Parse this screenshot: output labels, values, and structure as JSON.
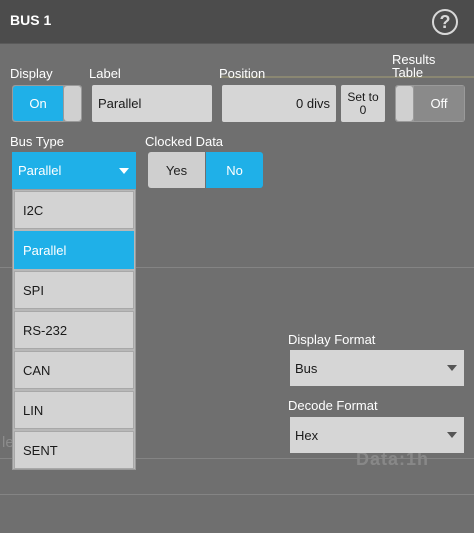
{
  "window": {
    "title": "BUS 1",
    "help_glyph": "?"
  },
  "display": {
    "label": "Display",
    "value": "On"
  },
  "label_field": {
    "label": "Label",
    "value": "Parallel"
  },
  "position": {
    "label": "Position",
    "value": "0 divs",
    "set_button": "Set to 0"
  },
  "results_table": {
    "label": "Results Table",
    "value": "Off"
  },
  "bus_type": {
    "label": "Bus Type",
    "selected": "Parallel",
    "options": [
      "I2C",
      "Parallel",
      "SPI",
      "RS-232",
      "CAN",
      "LIN",
      "SENT"
    ]
  },
  "clocked_data": {
    "label": "Clocked Data",
    "yes": "Yes",
    "no": "No",
    "selected": "No"
  },
  "display_format": {
    "label": "Display Format",
    "value": "Bus"
  },
  "decode_format": {
    "label": "Decode Format",
    "value": "Hex"
  },
  "background": {
    "watermark": "Data:1h",
    "edge_text": "le"
  },
  "colors": {
    "accent": "#1fb0e8",
    "panel": "#6f6f6f",
    "titlebar": "#4c4c4c"
  }
}
